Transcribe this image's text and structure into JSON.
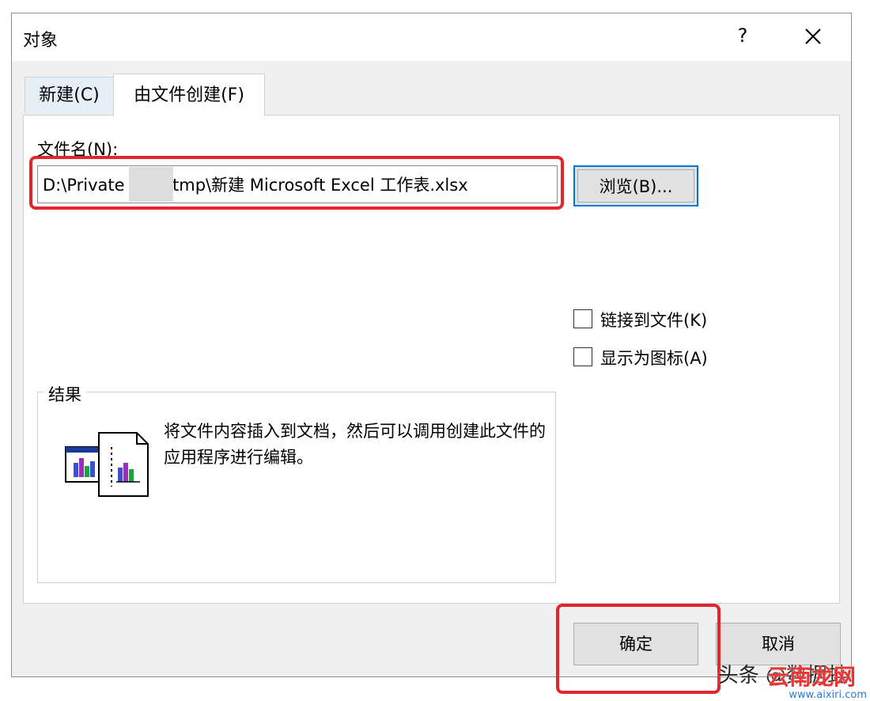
{
  "dialog": {
    "title": "对象",
    "help": "?",
    "tabs": [
      {
        "label": "新建(C)"
      },
      {
        "label": "由文件创建(F)"
      }
    ],
    "filename_label": "文件名(N):",
    "filename_value": "D:\\Private        \\tmp\\新建 Microsoft Excel 工作表.xlsx",
    "browse_label": "浏览(B)...",
    "options": [
      {
        "label": "链接到文件(K)",
        "checked": false
      },
      {
        "label": "显示为图标(A)",
        "checked": false
      }
    ],
    "result_title": "结果",
    "result_text": "将文件内容插入到文档，然后可以调用创建此文件的应用程序进行编辑。",
    "ok_label": "确定",
    "cancel_label": "取消"
  },
  "watermark": {
    "text": "头条 @数据蛙",
    "site_name": "云南龙网",
    "site_url": "www.aixiri.com"
  },
  "colors": {
    "highlight": "#e3262d",
    "focus": "#0078d7"
  }
}
